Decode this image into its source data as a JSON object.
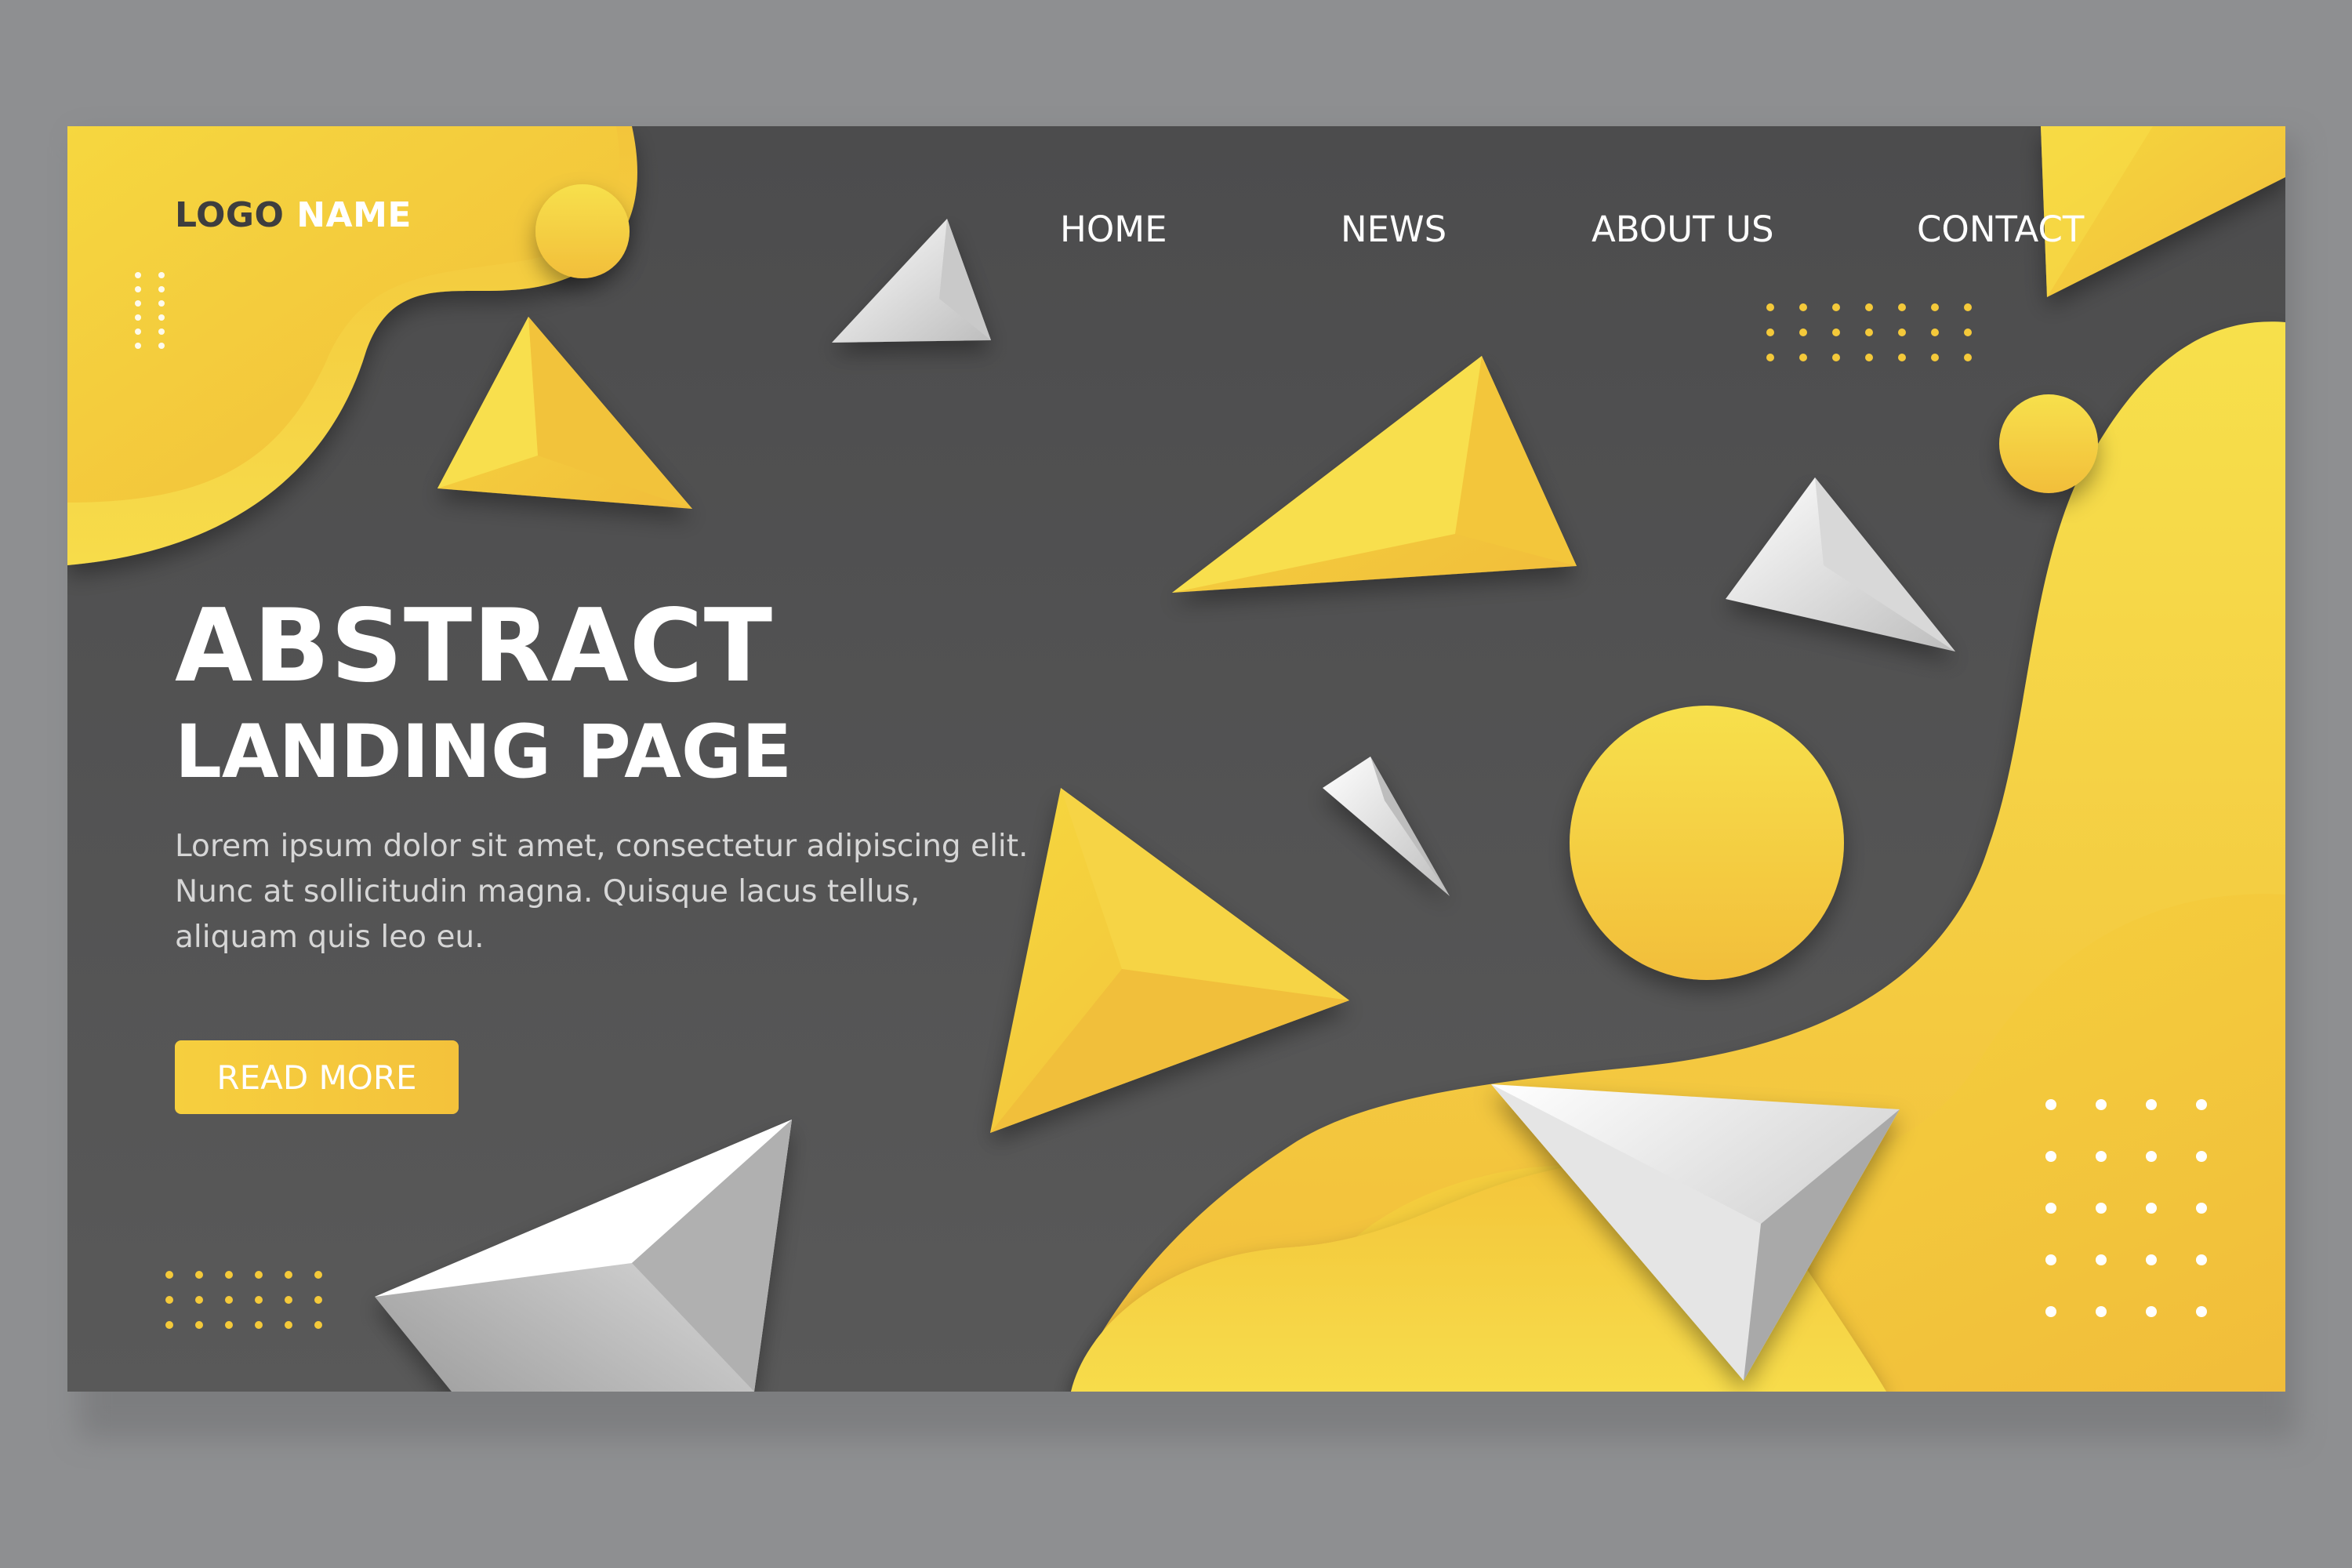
{
  "logo": {
    "part1": "LOGO",
    "part2": "NAME"
  },
  "nav": {
    "items": [
      "HOME",
      "NEWS",
      "ABOUT US",
      "CONTACT"
    ]
  },
  "hero": {
    "title": "ABSTRACT",
    "subtitle": "LANDING PAGE",
    "body": "Lorem ipsum dolor sit amet, consectetur adipiscing elit. Nunc at sollicitudin magna. Quisque lacus tellus, aliquam quis leo eu.",
    "cta_label": "READ MORE"
  },
  "colors": {
    "background": "#8e8f91",
    "page": "#525252",
    "accent": "#f5c93a",
    "accent_light": "#f7dd4a",
    "text": "#ffffff"
  }
}
